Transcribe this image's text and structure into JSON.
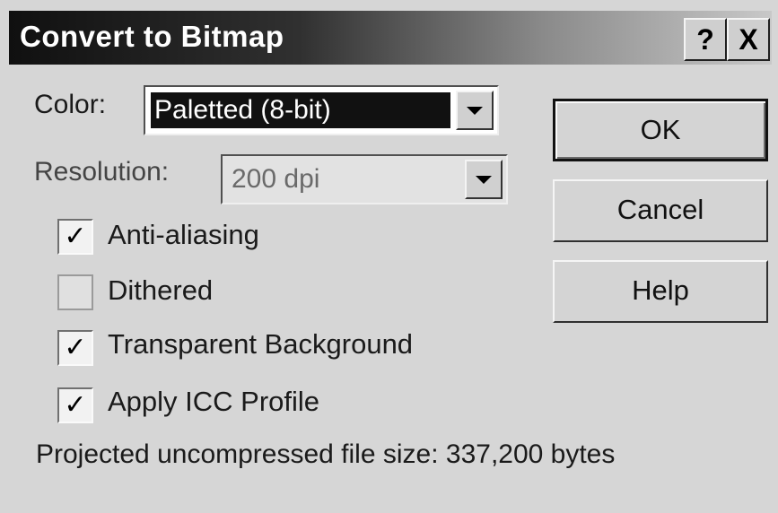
{
  "dialog": {
    "title": "Convert to Bitmap",
    "help_button": "?",
    "close_button": "X"
  },
  "color": {
    "label": "Color:",
    "value": "Paletted (8-bit)"
  },
  "resolution": {
    "label": "Resolution:",
    "value": "200 dpi"
  },
  "options": [
    {
      "label": "Anti-aliasing",
      "checked": true
    },
    {
      "label": "Dithered",
      "checked": false
    },
    {
      "label": "Transparent Background",
      "checked": true
    },
    {
      "label": "Apply ICC Profile",
      "checked": true
    }
  ],
  "buttons": {
    "ok": "OK",
    "cancel": "Cancel",
    "help": "Help"
  },
  "status": "Projected uncompressed file size: 337,200 bytes"
}
